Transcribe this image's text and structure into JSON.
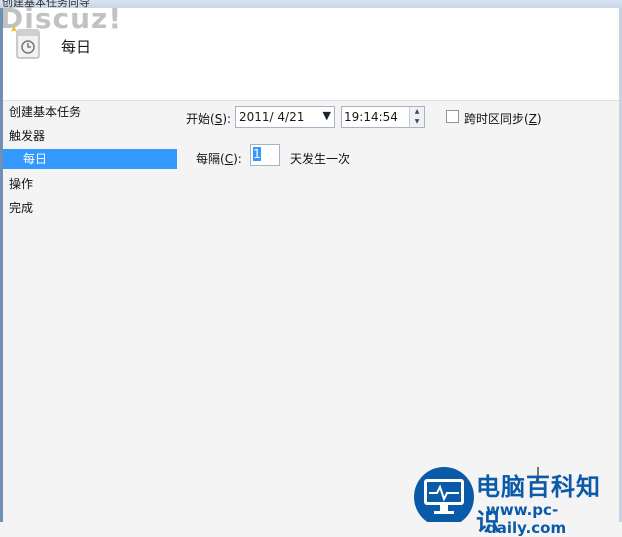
{
  "window": {
    "title": "创建基本任务向导",
    "watermark": "Discuz!"
  },
  "header": {
    "title": "每日"
  },
  "nav": {
    "items": [
      {
        "label": "创建基本任务",
        "selected": false,
        "indent": false
      },
      {
        "label": "触发器",
        "selected": false,
        "indent": false
      },
      {
        "label": "每日",
        "selected": true,
        "indent": true
      },
      {
        "label": "操作",
        "selected": false,
        "indent": false
      },
      {
        "label": "完成",
        "selected": false,
        "indent": false
      }
    ]
  },
  "trigger": {
    "start_label_prefix": "开始(",
    "start_label_key": "S",
    "start_label_suffix": "):",
    "date_value": "2011/  4/21",
    "time_value": "19:14:54",
    "sync_label_prefix": "跨时区同步(",
    "sync_label_key": "Z",
    "sync_label_suffix": ")",
    "sync_checked": false,
    "recur_label_prefix": "每隔(",
    "recur_label_key": "C",
    "recur_label_suffix": "):",
    "recur_value": "1",
    "recur_unit": "天发生一次"
  },
  "logo": {
    "main_text": "电脑百科知识",
    "url": "www.pc-daily.com",
    "accent_color": "#0a5aa8"
  },
  "colors": {
    "selection": "#3399ff"
  }
}
